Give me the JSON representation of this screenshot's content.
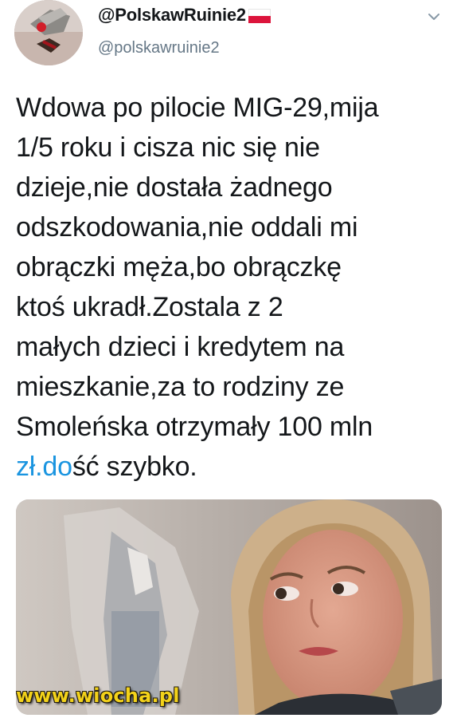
{
  "user": {
    "display_name": "@PolskawRuinie2",
    "handle": "@polskawruinie2",
    "flag_icon": "poland-flag-icon",
    "avatar_icon": "avatar-image"
  },
  "menu": {
    "icon": "chevron-down-icon"
  },
  "tweet": {
    "lines": [
      "Wdowa po pilocie MIG-29,mija",
      "1/5 roku i cisza nic się nie",
      "dzieje,nie dostała żadnego",
      "odszkodowania,nie oddali mi",
      "obrączki męża,bo obrączkę",
      "ktoś ukradł.Zostala z 2",
      "małych dzieci i kredytem na",
      "mieszkanie,za to rodziny ze",
      "Smoleńska otrzymały 100 mln"
    ],
    "last_line_link": "zł.do",
    "last_line_rest": "ść szybko.",
    "link_color": "#1b95e0"
  },
  "media": {
    "watermark": "www.wiocha.pl"
  }
}
